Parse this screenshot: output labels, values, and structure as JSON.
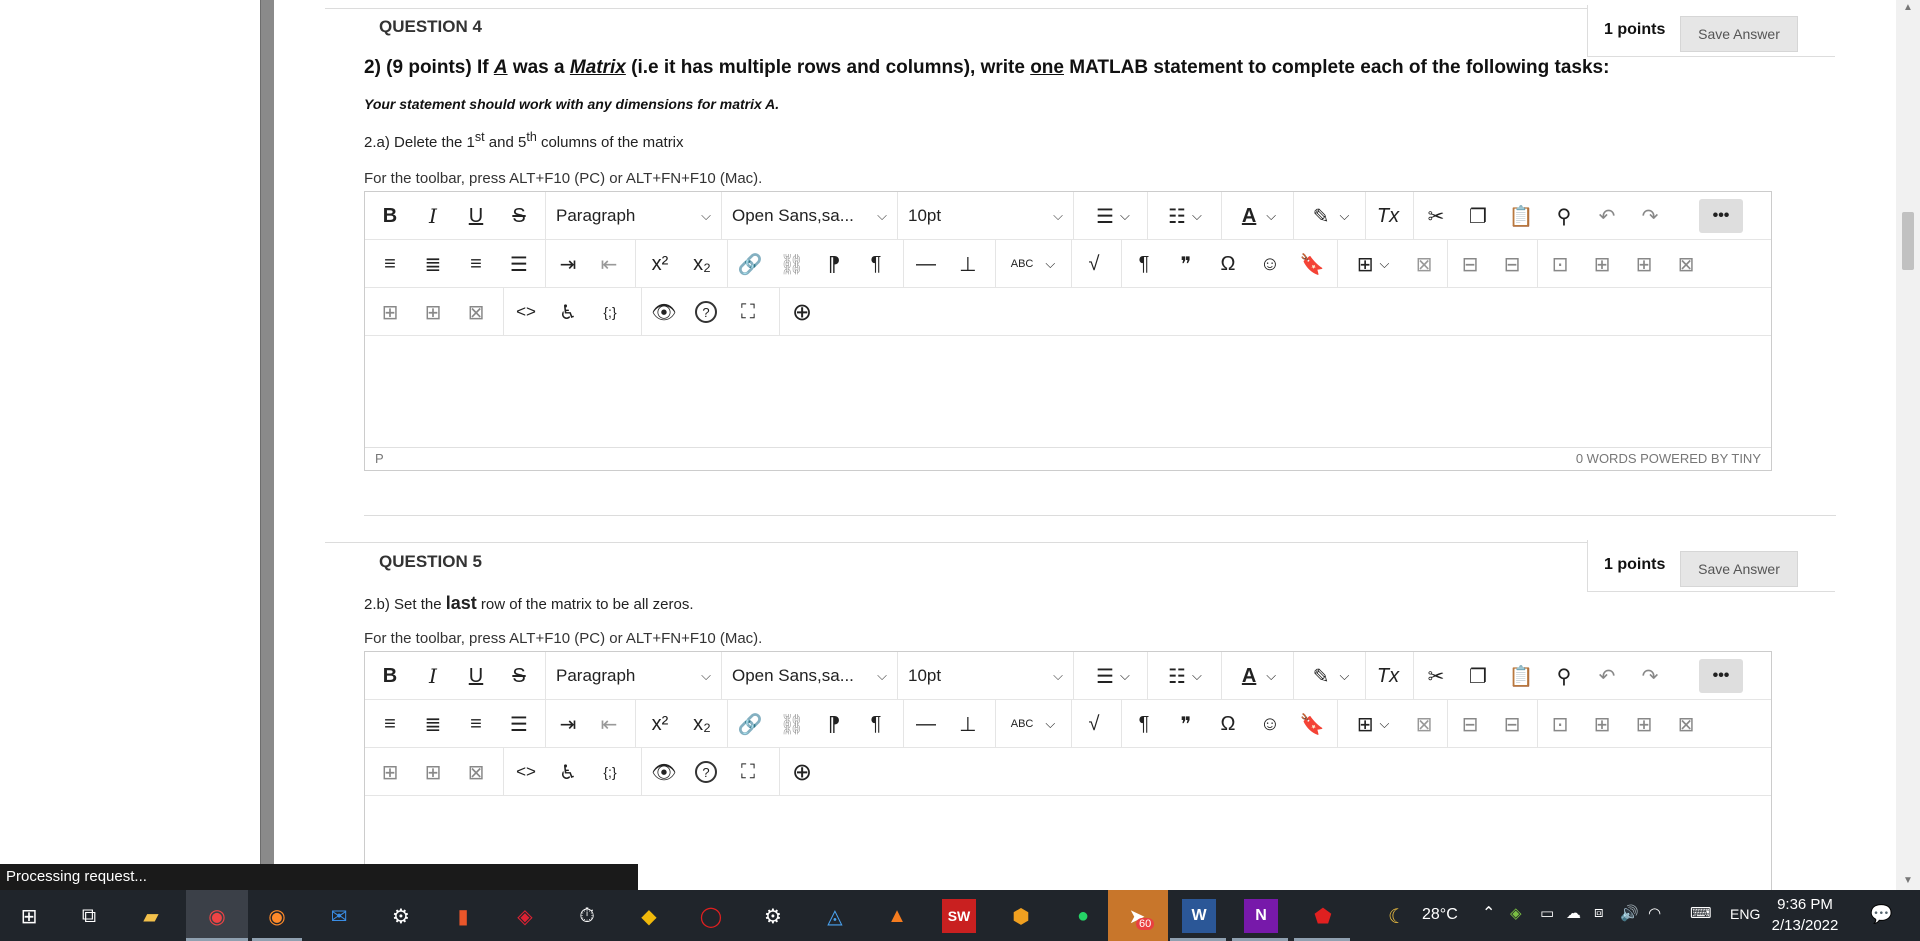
{
  "q4": {
    "header": "QUESTION 4",
    "points": "1 points",
    "save_label": "Save Answer",
    "prefix": "2) (9 points) If ",
    "var": "A",
    "mid1": " was a ",
    "matrix": "Matrix",
    "mid2": " (i.e it has multiple rows and columns), write ",
    "one": "one",
    "tail": " MATLAB statement to complete each of the following tasks:",
    "note": "Your statement should work with any dimensions for matrix A.",
    "task_a": "2.a) Delete the 1",
    "task_sup1": "st",
    "task_b": " and 5",
    "task_sup2": "th",
    "task_c": " columns of the matrix",
    "hint": "For the toolbar, press ALT+F10 (PC) or ALT+FN+F10 (Mac).",
    "status_p": "P",
    "words": "0 WORDS  POWERED BY TINY"
  },
  "q5": {
    "header": "QUESTION 5",
    "points": "1 points",
    "save_label": "Save Answer",
    "task_a": "2.b) Set the ",
    "task_bold": "last",
    "task_b": " row of the matrix to be all zeros.",
    "hint": "For the toolbar, press ALT+F10 (PC) or ALT+FN+F10 (Mac)."
  },
  "toolbar": {
    "bold": "B",
    "italic": "I",
    "underline": "U",
    "strike": "S",
    "paragraph": "Paragraph",
    "font": "Open Sans,sa...",
    "size": "10pt",
    "text_color": "A",
    "clear_format": "Tx",
    "superscript": "x²",
    "subscript": "x₂",
    "spellcheck": "ABC",
    "pilcrow": "¶",
    "quote": "❞",
    "omega": "Ω",
    "code": "<>",
    "source": "{;}",
    "help": "?",
    "more": "•••"
  },
  "status_popup": "Processing request...",
  "taskbar": {
    "weather": "28°C",
    "lang": "ENG",
    "time": "9:36 PM",
    "date": "2/13/2022",
    "telegram_badge": "60",
    "sw_label": "SW",
    "word_label": "W",
    "onenote_label": "N"
  }
}
